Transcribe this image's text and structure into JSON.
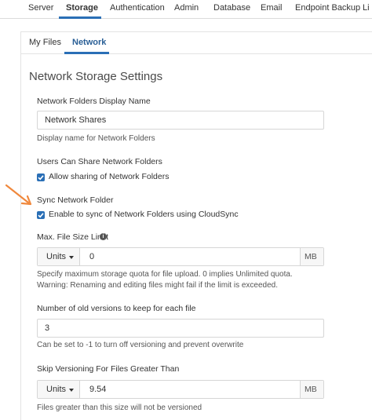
{
  "top_nav": {
    "tabs": [
      {
        "label": "Server"
      },
      {
        "label": "Storage"
      },
      {
        "label": "Authentication"
      },
      {
        "label": "Admin"
      },
      {
        "label": "Database"
      },
      {
        "label": "Email"
      },
      {
        "label": "Endpoint Backup"
      },
      {
        "label": "Li"
      }
    ],
    "active": "Storage"
  },
  "sub_nav": {
    "tabs": [
      {
        "label": "My Files"
      },
      {
        "label": "Network"
      }
    ],
    "active": "Network"
  },
  "section": {
    "title": "Network Storage Settings"
  },
  "display_name": {
    "label": "Network Folders Display Name",
    "value": "Network Shares",
    "help": "Display name for Network Folders"
  },
  "share": {
    "label": "Users Can Share Network Folders",
    "checkbox_label": "Allow sharing of Network Folders",
    "checked": true
  },
  "sync": {
    "label": "Sync Network Folder",
    "checkbox_label": "Enable to sync of Network Folders using CloudSync",
    "checked": true
  },
  "max_size": {
    "label": "Max. File Size Limit",
    "units_label": "Units",
    "value": "0",
    "unit": "MB",
    "help": "Specify maximum storage quota for file upload. 0 implies Unlimited quota. Warning: Renaming and editing files might fail if the limit is exceeded."
  },
  "versions": {
    "label": "Number of old versions to keep for each file",
    "value": "3",
    "help": "Can be set to -1 to turn off versioning and prevent overwrite"
  },
  "skip_versioning": {
    "label": "Skip Versioning For Files Greater Than",
    "units_label": "Units",
    "value": "9.54",
    "unit": "MB",
    "help": "Files greater than this size will not be versioned"
  },
  "colors": {
    "accent": "#2a6fb6",
    "arrow": "#f0883c"
  },
  "icons": {
    "info": "info-circle-icon",
    "check": "checkmark-icon",
    "caret": "caret-down-icon",
    "arrow": "pointer-arrow-icon"
  }
}
